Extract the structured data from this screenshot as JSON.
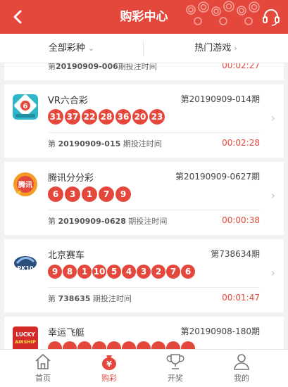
{
  "header": {
    "title": "购彩中心"
  },
  "filter": {
    "all_types": "全部彩种",
    "hot_games": "热门游戏",
    "all_types_arrow": "⌄",
    "hot_games_arrow": "›"
  },
  "lotteries": [
    {
      "name": "",
      "period": "",
      "next_prefix": "第",
      "next_period": "20190909-006",
      "next_suffix": "期投注时间",
      "countdown": "00:02:27",
      "balls": []
    },
    {
      "name": "VR六合彩",
      "period": "第20190909-014期",
      "next_prefix": "第",
      "next_period": "20190909-015",
      "next_suffix": " 期投注时间",
      "countdown": "00:02:28",
      "balls": [
        "31",
        "37",
        "22",
        "28",
        "36",
        "20",
        "23"
      ]
    },
    {
      "name": "腾讯分分彩",
      "period": "第20190909-0627期",
      "next_prefix": "第",
      "next_period": "20190909-0628",
      "next_suffix": " 期投注时间",
      "countdown": "00:00:38",
      "balls": [
        "6",
        "3",
        "1",
        "7",
        "9"
      ]
    },
    {
      "name": "北京赛车",
      "period": "第738634期",
      "next_prefix": "第",
      "next_period": "738635",
      "next_suffix": " 期投注时间",
      "countdown": "00:01:47",
      "balls": [
        "9",
        "8",
        "1",
        "10",
        "5",
        "4",
        "3",
        "2",
        "7",
        "6"
      ]
    },
    {
      "name": "幸运飞艇",
      "period": "第20190908-180期",
      "balls": [
        "",
        "",
        "",
        "",
        "",
        "",
        "",
        "",
        "",
        ""
      ]
    }
  ],
  "tabs": [
    {
      "label": "首页",
      "icon": "home-icon"
    },
    {
      "label": "购彩",
      "icon": "money-bag-icon"
    },
    {
      "label": "开奖",
      "icon": "trophy-icon"
    },
    {
      "label": "我的",
      "icon": "user-icon"
    }
  ],
  "colors": {
    "brand": "#e4483c",
    "tab_active": "#e4483c"
  }
}
